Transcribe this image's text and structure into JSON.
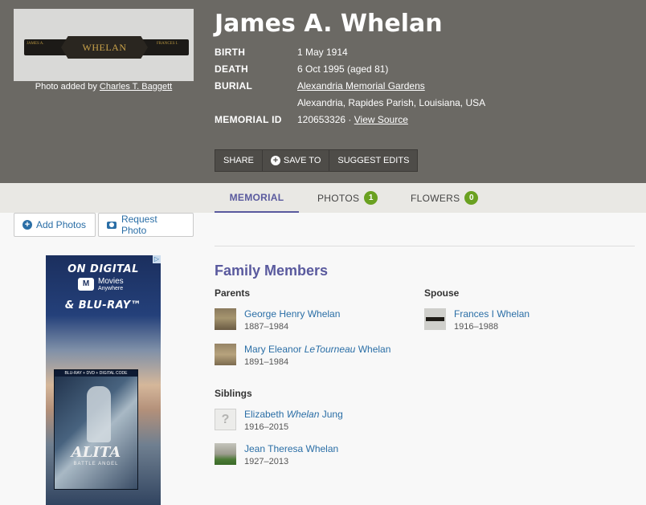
{
  "memorial": {
    "name": "James A. Whelan",
    "photo": {
      "caption_prefix": "Photo added by",
      "contributor": "Charles T. Baggett",
      "plaque_text": "WHELAN",
      "plaque_left": "JAMES A.",
      "plaque_right": "FRANCES I."
    },
    "birth_label": "BIRTH",
    "birth": "1 May 1914",
    "death_label": "DEATH",
    "death": "6 Oct 1995 (aged 81)",
    "burial_label": "BURIAL",
    "burial_place": "Alexandria Memorial Gardens",
    "burial_location": "Alexandria, Rapides Parish, Louisiana, USA",
    "id_label": "MEMORIAL ID",
    "id": "120653326",
    "id_separator": " · ",
    "view_source": "View Source"
  },
  "actions": {
    "share": "SHARE",
    "save_icon": "+",
    "save": "SAVE TO",
    "suggest": "SUGGEST EDITS"
  },
  "tabs": {
    "memorial": "MEMORIAL",
    "photos": "PHOTOS",
    "photos_count": "1",
    "flowers": "FLOWERS",
    "flowers_count": "0"
  },
  "photo_buttons": {
    "add": "Add Photos",
    "request": "Request Photo"
  },
  "ad": {
    "line1": "ON DIGITAL",
    "brand": "Movies",
    "brand_sub": "Anywhere",
    "line2": "& BLU-RAY™",
    "box_top": "BLU-RAY + DVD + DIGITAL CODE",
    "title": "ALITA",
    "subtitle": "BATTLE ANGEL"
  },
  "family": {
    "title": "Family Members",
    "parents_label": "Parents",
    "spouse_label": "Spouse",
    "siblings_label": "Siblings",
    "parents": [
      {
        "name": "George Henry Whelan",
        "dates": "1887–1984"
      },
      {
        "first": "Mary Eleanor",
        "maiden": "LeTourneau",
        "last": "Whelan",
        "dates": "1891–1984"
      }
    ],
    "spouse": [
      {
        "name": "Frances I Whelan",
        "dates": "1916–1988"
      }
    ],
    "siblings": [
      {
        "first": "Elizabeth",
        "maiden": "Whelan",
        "last": "Jung",
        "dates": "1916–2015"
      },
      {
        "name": "Jean Theresa Whelan",
        "dates": "1927–2013"
      }
    ]
  }
}
